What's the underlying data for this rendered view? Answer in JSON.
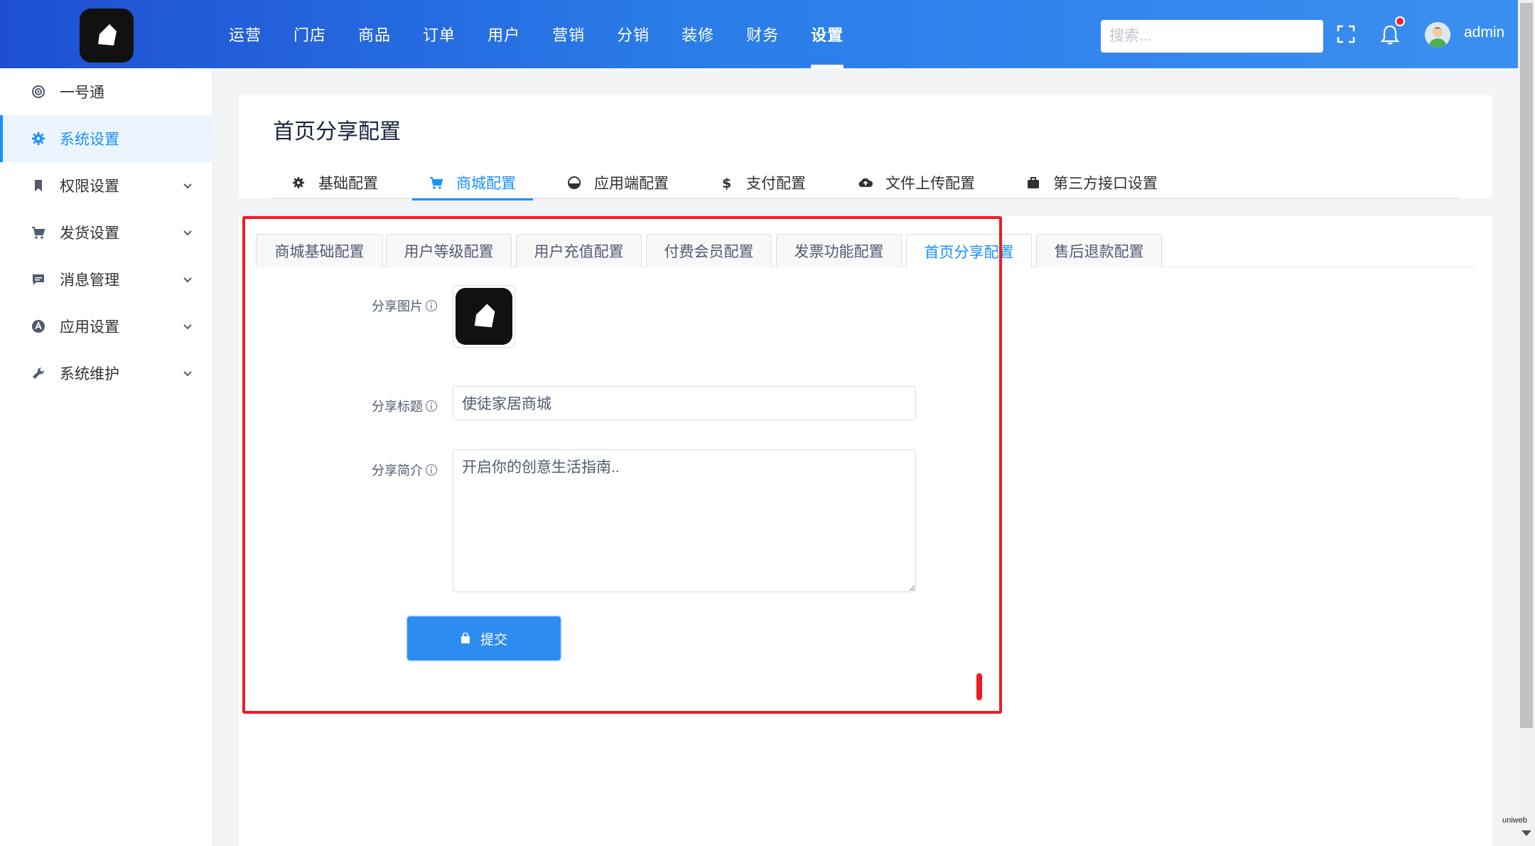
{
  "header": {
    "nav": [
      "运营",
      "门店",
      "商品",
      "订单",
      "用户",
      "营销",
      "分销",
      "装修",
      "财务",
      "设置"
    ],
    "active_nav": "设置",
    "search_placeholder": "搜索...",
    "username": "admin"
  },
  "sidebar": {
    "items": [
      {
        "label": "一号通",
        "icon": "target-icon",
        "expandable": false
      },
      {
        "label": "系统设置",
        "icon": "gear-icon",
        "expandable": false,
        "active": true
      },
      {
        "label": "权限设置",
        "icon": "bookmark-icon",
        "expandable": true
      },
      {
        "label": "发货设置",
        "icon": "cart-icon",
        "expandable": true
      },
      {
        "label": "消息管理",
        "icon": "message-icon",
        "expandable": true
      },
      {
        "label": "应用设置",
        "icon": "app-icon",
        "expandable": true
      },
      {
        "label": "系统维护",
        "icon": "wrench-icon",
        "expandable": true
      }
    ]
  },
  "page": {
    "title": "首页分享配置",
    "tabs": [
      {
        "label": "基础配置",
        "icon": "gear-icon"
      },
      {
        "label": "商城配置",
        "icon": "cart-icon",
        "active": true
      },
      {
        "label": "应用端配置",
        "icon": "gauge-icon"
      },
      {
        "label": "支付配置",
        "icon": "dollar-icon"
      },
      {
        "label": "文件上传配置",
        "icon": "cloud-upload-icon"
      },
      {
        "label": "第三方接口设置",
        "icon": "briefcase-icon"
      }
    ],
    "subtabs": [
      "商城基础配置",
      "用户等级配置",
      "用户充值配置",
      "付费会员配置",
      "发票功能配置",
      "首页分享配置",
      "售后退款配置"
    ],
    "active_subtab": "首页分享配置"
  },
  "form": {
    "share_image_label": "分享图片",
    "share_title_label": "分享标题",
    "share_title_value": "使徒家居商城",
    "share_desc_label": "分享简介",
    "share_desc_value": "开启你的创意生活指南..",
    "submit_label": "提交"
  },
  "misc": {
    "corner_text": "uniweb"
  },
  "colors": {
    "accent": "#1890ff",
    "header_gradient_start": "#1e4fd1",
    "header_gradient_end": "#3b8ff0",
    "annotation": "#ee1c25"
  }
}
